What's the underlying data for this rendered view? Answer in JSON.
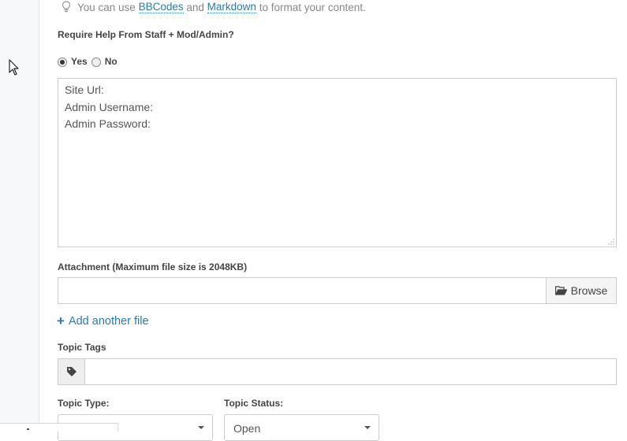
{
  "hint": {
    "prefix": "You can use ",
    "bbcodes_link": "BBCodes",
    "middle": " and ",
    "markdown_link": "Markdown",
    "suffix": " to format your content."
  },
  "help": {
    "label": "Require Help From Staff + Mod/Admin?",
    "options": [
      {
        "label": "Yes",
        "selected": true
      },
      {
        "label": "No",
        "selected": false
      }
    ]
  },
  "content": {
    "lines": [
      "Site Url:",
      "Admin Username:",
      "Admin Password:"
    ]
  },
  "attachment": {
    "label": "Attachment (Maximum file size is 2048KB)",
    "value": "",
    "browse_label": "Browse",
    "add_another_label": "Add another file"
  },
  "tags": {
    "label": "Topic Tags",
    "value": "",
    "icon": "tag-icon"
  },
  "topic_type": {
    "label": "Topic Type:",
    "value": ""
  },
  "topic_status": {
    "label": "Topic Status:",
    "value": "Open"
  },
  "colors": {
    "link": "#2a7ab0",
    "text": "#333333",
    "border": "#cccccc"
  }
}
